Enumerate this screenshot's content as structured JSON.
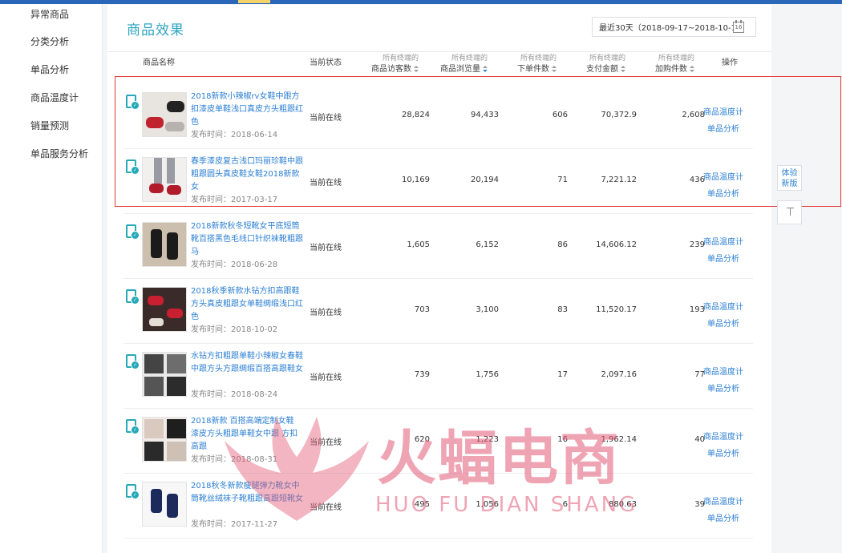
{
  "sidebar": {
    "items": [
      {
        "label": "异常商品"
      },
      {
        "label": "分类分析"
      },
      {
        "label": "单品分析"
      },
      {
        "label": "商品温度计"
      },
      {
        "label": "销量预测"
      },
      {
        "label": "单品服务分析"
      }
    ]
  },
  "page": {
    "title": "商品效果",
    "date_range": "最近30天（2018-09-17~2018-10-16）",
    "calendar_icon_text": "16"
  },
  "table": {
    "columns": [
      {
        "sub": "",
        "label": "商品名称"
      },
      {
        "sub": "",
        "label": "当前状态"
      },
      {
        "sub": "所有终端的",
        "label": "商品访客数"
      },
      {
        "sub": "所有终端的",
        "label": "商品浏览量"
      },
      {
        "sub": "所有终端的",
        "label": "下单件数"
      },
      {
        "sub": "所有终端的",
        "label": "支付金额"
      },
      {
        "sub": "所有终端的",
        "label": "加购件数"
      },
      {
        "sub": "",
        "label": "操作"
      }
    ],
    "op_labels": {
      "thermometer": "商品温度计",
      "analysis": "单品分析"
    },
    "rows": [
      {
        "name": "2018新款小辣椒rv女鞋中跟方扣漆皮单鞋浅口真皮方头粗跟红色",
        "time": "发布时间：2018-06-14",
        "status": "当前在线",
        "visitors": "28,824",
        "views": "94,433",
        "orders": "606",
        "payment": "70,372.9",
        "cart": "2,608"
      },
      {
        "name": "春季漆皮复古浅口玛丽珍鞋中跟粗跟圆头真皮鞋女鞋2018新款女",
        "time": "发布时间：2017-03-17",
        "status": "当前在线",
        "visitors": "10,169",
        "views": "20,194",
        "orders": "71",
        "payment": "7,221.12",
        "cart": "436"
      },
      {
        "name": "2018新款秋冬短靴女平底短筒靴百搭黑色毛线口针织袜靴粗跟马",
        "time": "发布时间：2018-06-28",
        "status": "当前在线",
        "visitors": "1,605",
        "views": "6,152",
        "orders": "86",
        "payment": "14,606.12",
        "cart": "239"
      },
      {
        "name": "2018秋季新款水钻方扣高跟鞋方头真皮粗跟女单鞋绸缎浅口红色",
        "time": "发布时间：2018-10-02",
        "status": "当前在线",
        "visitors": "703",
        "views": "3,100",
        "orders": "83",
        "payment": "11,520.17",
        "cart": "193"
      },
      {
        "name": "水钻方扣粗跟单鞋小辣椒女春鞋中跟方头方跟绸缎百搭高跟鞋女",
        "time": "发布时间：2018-08-24",
        "status": "当前在线",
        "visitors": "739",
        "views": "1,756",
        "orders": "17",
        "payment": "2,097.16",
        "cart": "77"
      },
      {
        "name": "2018新款 百搭高端定制女鞋 漆皮方头粗跟单鞋女中跟 方扣高跟",
        "time": "发布时间：2018-08-31",
        "status": "当前在线",
        "visitors": "620",
        "views": "1,223",
        "orders": "16",
        "payment": "1,962.14",
        "cart": "40"
      },
      {
        "name": "2018秋冬新款瘦腿弹力靴女中筒靴丝绒袜子靴粗跟高跟短靴女",
        "time": "发布时间：2017-11-27",
        "status": "当前在线",
        "visitors": "495",
        "views": "1,056",
        "orders": "6",
        "payment": "880.63",
        "cart": "39"
      }
    ]
  },
  "float": {
    "try_new": "体验新版"
  },
  "watermark": {
    "cn": "火蝠电商",
    "en": "HUO FU DIAN SHANG"
  },
  "colors": {
    "title": "#2fa5c2",
    "link": "#2b7fd3",
    "highlight": "#e53935",
    "watermark": "#e25a76"
  }
}
